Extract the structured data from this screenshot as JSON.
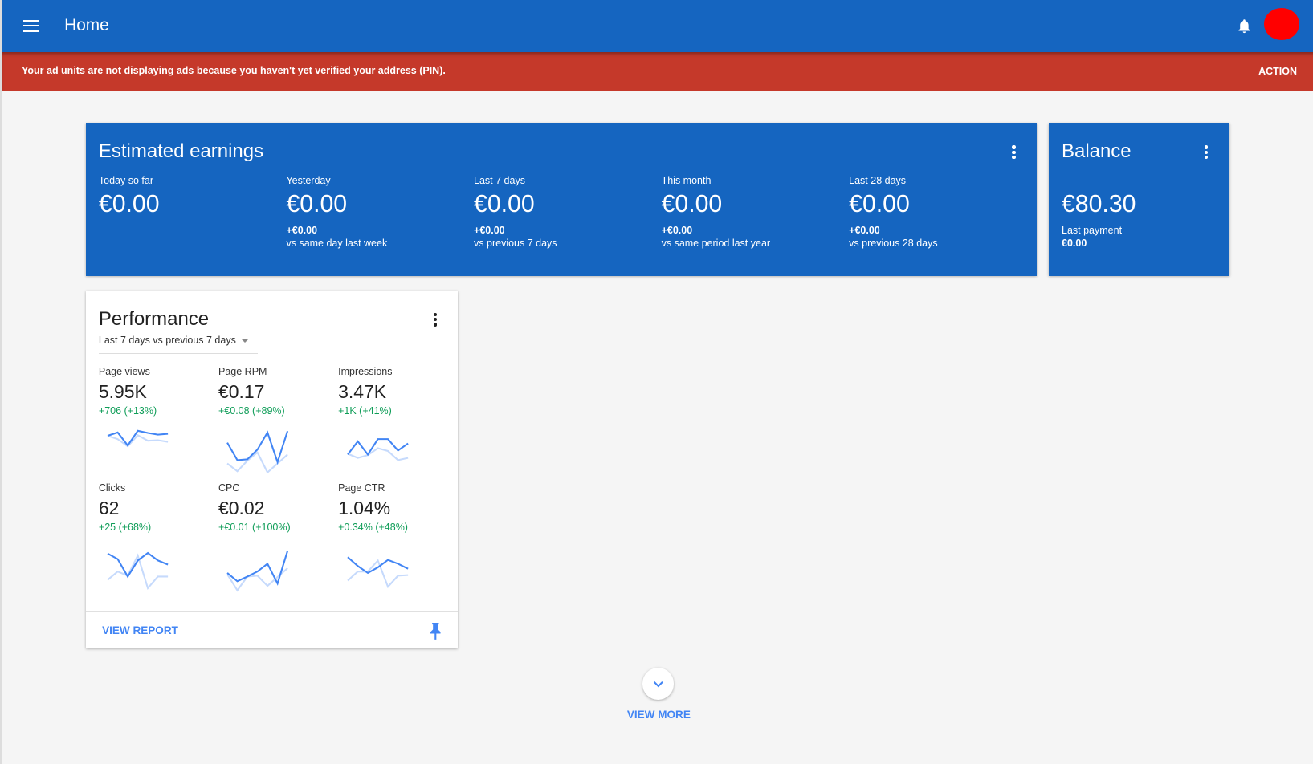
{
  "header": {
    "title": "Home",
    "icons": [
      "menu-icon",
      "bell-icon",
      "avatar"
    ]
  },
  "banner": {
    "message": "Your ad units are not displaying ads because you haven't yet verified your address (PIN).",
    "action": "ACTION"
  },
  "earnings": {
    "title": "Estimated earnings",
    "columns": [
      {
        "label": "Today so far",
        "value": "€0.00",
        "delta": "",
        "compare": ""
      },
      {
        "label": "Yesterday",
        "value": "€0.00",
        "delta": "+€0.00",
        "compare": "vs same day last week"
      },
      {
        "label": "Last 7 days",
        "value": "€0.00",
        "delta": "+€0.00",
        "compare": "vs previous 7 days"
      },
      {
        "label": "This month",
        "value": "€0.00",
        "delta": "+€0.00",
        "compare": "vs same period last year"
      },
      {
        "label": "Last 28 days",
        "value": "€0.00",
        "delta": "+€0.00",
        "compare": "vs previous 28 days"
      }
    ]
  },
  "balance": {
    "title": "Balance",
    "value": "€80.30",
    "last_payment_label": "Last payment",
    "last_payment_value": "€0.00"
  },
  "performance": {
    "title": "Performance",
    "range": "Last 7 days vs previous 7 days",
    "view_report": "VIEW REPORT",
    "metrics": [
      {
        "label": "Page views",
        "value": "5.95K",
        "delta": "+706 (+13%)",
        "current": [
          140,
          152,
          105,
          158,
          150,
          144,
          147
        ],
        "previous": [
          140,
          128,
          102,
          142,
          122,
          124,
          118
        ]
      },
      {
        "label": "Page RPM",
        "value": "€0.17",
        "delta": "+€0.08 (+89%)",
        "current": [
          115,
          52,
          55,
          90,
          152,
          45,
          157
        ],
        "previous": [
          40,
          12,
          50,
          80,
          8,
          40,
          72
        ]
      },
      {
        "label": "Impressions",
        "value": "3.47K",
        "delta": "+1K (+41%)",
        "current": [
          72,
          120,
          72,
          128,
          128,
          87,
          112
        ],
        "previous": [
          75,
          60,
          70,
          95,
          85,
          52,
          60
        ]
      },
      {
        "label": "Clicks",
        "value": "62",
        "delta": "+25 (+68%)",
        "current": [
          135,
          115,
          52,
          110,
          137,
          110,
          95
        ],
        "previous": [
          40,
          70,
          55,
          128,
          10,
          52,
          52
        ]
      },
      {
        "label": "CPC",
        "value": "€0.02",
        "delta": "+€0.01 (+100%)",
        "current": [
          65,
          35,
          52,
          70,
          98,
          27,
          145
        ],
        "previous": [
          60,
          2,
          52,
          55,
          18,
          50,
          82
        ]
      },
      {
        "label": "Page CTR",
        "value": "1.04%",
        "delta": "+0.34% (+48%)",
        "current": [
          122,
          90,
          65,
          85,
          112,
          98,
          80
        ],
        "previous": [
          37,
          70,
          70,
          110,
          15,
          55,
          57
        ]
      }
    ]
  },
  "view_more": "VIEW MORE",
  "colors": {
    "primary": "#1565c0",
    "banner": "#c5392a",
    "positive": "#0f9d58",
    "link": "#4285f4",
    "spark_current": "#4285f4",
    "spark_previous": "#c6dafc"
  }
}
